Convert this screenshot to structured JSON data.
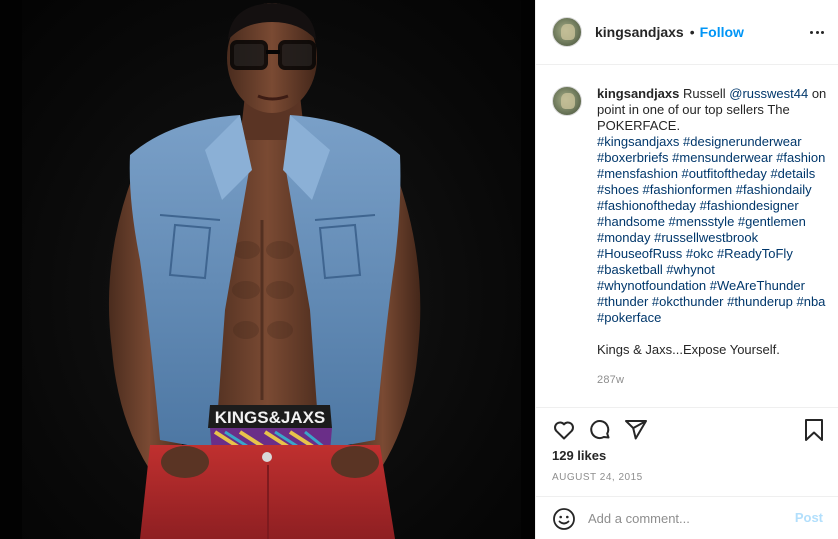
{
  "post": {
    "photo_alt": "",
    "username": "kingsandjaxs",
    "dot": "•",
    "follow_label": "Follow",
    "more_icon": "more-horizontal-icon"
  },
  "caption": {
    "username": "kingsandjaxs",
    "intro": "Russell",
    "mention": "@russwest44",
    "after_mention": "on point in one of our top sellers The POKERFACE.",
    "hashtags": "#kingsandjaxs #designerunderwear #boxerbriefs #mensunderwear #fashion #mensfashion #outfitoftheday #details #shoes #fashionformen #fashiondaily #fashionoftheday #fashiondesigner #handsome #mensstyle #gentlemen #monday #russellwestbrook #HouseofRuss #okc #ReadyToFly #basketball #whynot #whynotfoundation #WeAreThunder #thunder #okcthunder #thunderup #nba #pokerface",
    "tagline": "Kings & Jaxs...Expose Yourself.",
    "time_ago": "287w"
  },
  "actions": {
    "likes": "129 likes",
    "date": "August 24, 2015",
    "comment_placeholder": "Add a comment...",
    "post_label": "Post",
    "icons": [
      "heart-icon",
      "comment-icon",
      "share-icon",
      "bookmark-icon",
      "emoji-icon"
    ]
  },
  "image_text": {
    "waistband": "KINGS&JAXS"
  },
  "colors": {
    "link": "#00376b",
    "follow": "#0095f6",
    "post_disabled": "#b2dffc",
    "vest": "#5d86b3",
    "pants": "#b3282d"
  }
}
